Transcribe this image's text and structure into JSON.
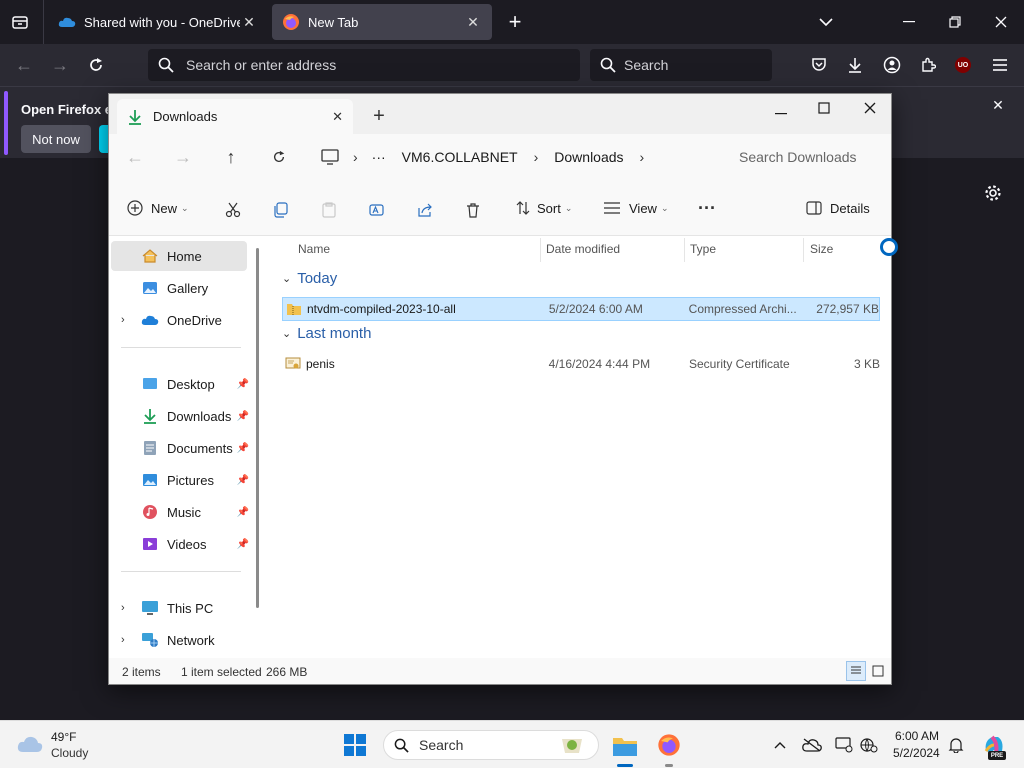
{
  "browser": {
    "tabs": [
      {
        "label": "Shared with you - OneDrive",
        "active": false
      },
      {
        "label": "New Tab",
        "active": true
      }
    ],
    "address_placeholder": "Search or enter address",
    "search_placeholder": "Search",
    "notice": {
      "text": "Open Firefox ev",
      "not_now": "Not now"
    },
    "addon_badge": "UO"
  },
  "explorer": {
    "tab_title": "Downloads",
    "breadcrumb": [
      "VM6.COLLABNET",
      "Downloads"
    ],
    "breadcrumb_more": "···",
    "search_placeholder": "Search Downloads",
    "commands": {
      "new": "New",
      "sort": "Sort",
      "view": "View",
      "more": "···",
      "details": "Details"
    },
    "nav": {
      "top": [
        {
          "label": "Home",
          "selected": true
        },
        {
          "label": "Gallery"
        },
        {
          "label": "OneDrive"
        }
      ],
      "quick": [
        {
          "label": "Desktop"
        },
        {
          "label": "Downloads"
        },
        {
          "label": "Documents"
        },
        {
          "label": "Pictures"
        },
        {
          "label": "Music"
        },
        {
          "label": "Videos"
        }
      ],
      "bottom": [
        {
          "label": "This PC"
        },
        {
          "label": "Network"
        }
      ]
    },
    "columns": {
      "name": "Name",
      "date": "Date modified",
      "type": "Type",
      "size": "Size"
    },
    "groups": [
      {
        "label": "Today",
        "files": [
          {
            "name": "ntvdm-compiled-2023-10-all",
            "date": "5/2/2024 6:00 AM",
            "type": "Compressed Archi...",
            "size": "272,957 KB",
            "selected": true
          }
        ]
      },
      {
        "label": "Last month",
        "files": [
          {
            "name": "penis",
            "date": "4/16/2024 4:44 PM",
            "type": "Security Certificate",
            "size": "3 KB",
            "selected": false
          }
        ]
      }
    ],
    "status": {
      "count": "2 items",
      "selected": "1 item selected",
      "size": "266 MB"
    }
  },
  "taskbar": {
    "weather_temp": "49°F",
    "weather_desc": "Cloudy",
    "search_label": "Search",
    "time": "6:00 AM",
    "date": "5/2/2024",
    "copilot_badge": "PRE"
  },
  "colors": {
    "accent": "#0067c0",
    "selection": "#cce8ff",
    "firefox_bg": "#1c1b22",
    "firefox_toolbar": "#2b2a33"
  }
}
